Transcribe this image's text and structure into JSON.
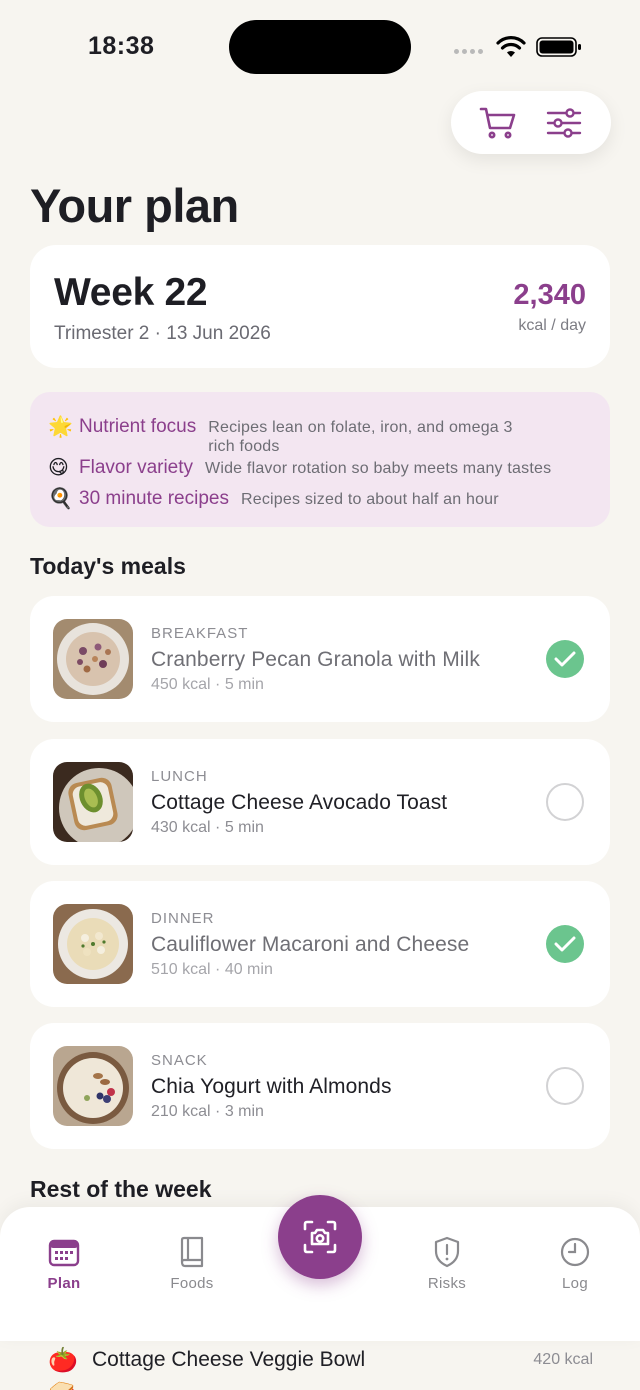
{
  "status": {
    "time": "18:38"
  },
  "header": {
    "title": "Your plan",
    "cart_icon": "cart-icon",
    "filter_icon": "sliders-icon"
  },
  "week": {
    "title": "Week 22",
    "subtitle": "Trimester 2 · 13 Jun 2026",
    "kcal": "2,340",
    "kcal_unit": "kcal / day"
  },
  "focus": [
    {
      "emoji": "🌟",
      "label": "Nutrient focus",
      "desc_line1": "Recipes lean on folate, iron, and omega 3",
      "desc_line2": "rich foods"
    },
    {
      "emoji": "😋",
      "label": "Flavor variety",
      "desc_line1": "Wide flavor rotation so baby meets many tastes",
      "desc_line2": ""
    },
    {
      "emoji": "🍳",
      "label": "30 minute recipes",
      "desc_line1": "Recipes sized to about half an hour",
      "desc_line2": ""
    }
  ],
  "today": {
    "title": "Today's meals",
    "meals": [
      {
        "type": "BREAKFAST",
        "name": "Cranberry Pecan Granola with Milk",
        "meta": "450 kcal · 5 min",
        "done": true
      },
      {
        "type": "LUNCH",
        "name": "Cottage Cheese Avocado Toast",
        "meta": "430 kcal · 5 min",
        "done": false
      },
      {
        "type": "DINNER",
        "name": "Cauliflower Macaroni and Cheese",
        "meta": "510 kcal · 40 min",
        "done": true
      },
      {
        "type": "SNACK",
        "name": "Chia Yogurt with Almonds",
        "meta": "210 kcal · 3 min",
        "done": false
      }
    ]
  },
  "rest": {
    "title": "Rest of the week",
    "items": [
      {
        "emoji": "🍅",
        "name": "Cottage Cheese Veggie Bowl",
        "kcal": "420 kcal"
      },
      {
        "emoji": "🥪",
        "name": "",
        "kcal": ""
      }
    ]
  },
  "nav": {
    "plan": "Plan",
    "foods": "Foods",
    "risks": "Risks",
    "log": "Log"
  },
  "colors": {
    "accent": "#8b3f8c",
    "check": "#6bc58e",
    "background": "#f7f5f0",
    "focus_bg": "#f3e6f1"
  }
}
